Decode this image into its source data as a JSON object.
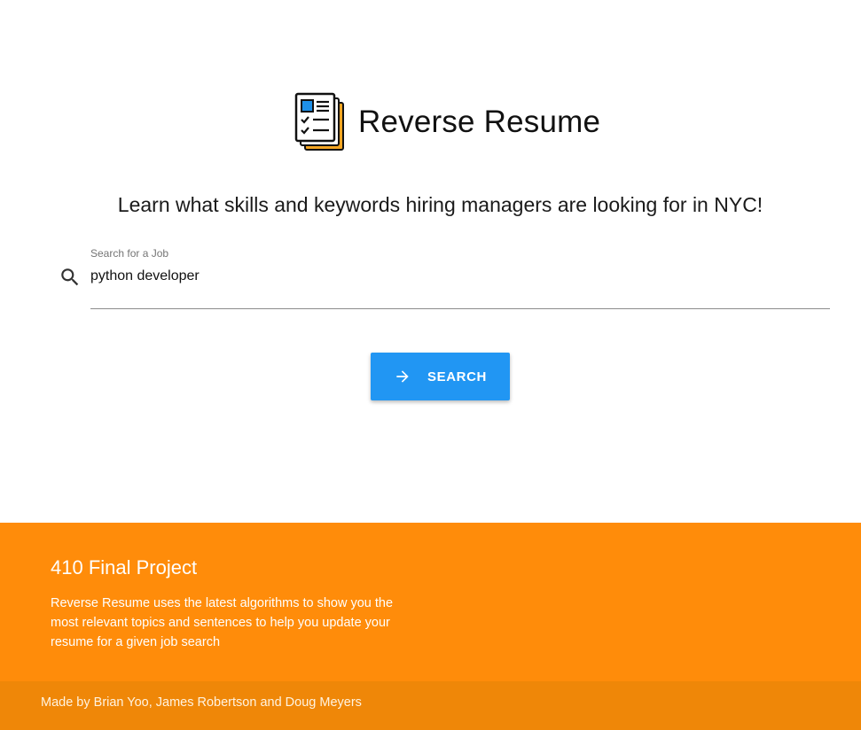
{
  "app": {
    "title": "Reverse Resume",
    "logo_icon": "resume-document-icon",
    "tagline": "Learn what skills and keywords hiring managers are looking for in NYC!"
  },
  "search": {
    "icon": "search-icon",
    "label": "Search for a Job",
    "value": "python developer",
    "button_icon": "arrow-right-icon",
    "button_label": "SEARCH"
  },
  "footer": {
    "title": "410 Final Project",
    "description": "Reverse Resume uses the latest algorithms to show you the most relevant topics and sentences to help you update your resume for a given job search",
    "credits": "Made by Brian Yoo, James Robertson and Doug Meyers"
  },
  "colors": {
    "accent": "#2196f3",
    "footer_background": "#ff8c0a",
    "footer_bottom_bar": "#ef8708",
    "logo_blue": "#1e90e8",
    "logo_orange": "#f5a623"
  }
}
